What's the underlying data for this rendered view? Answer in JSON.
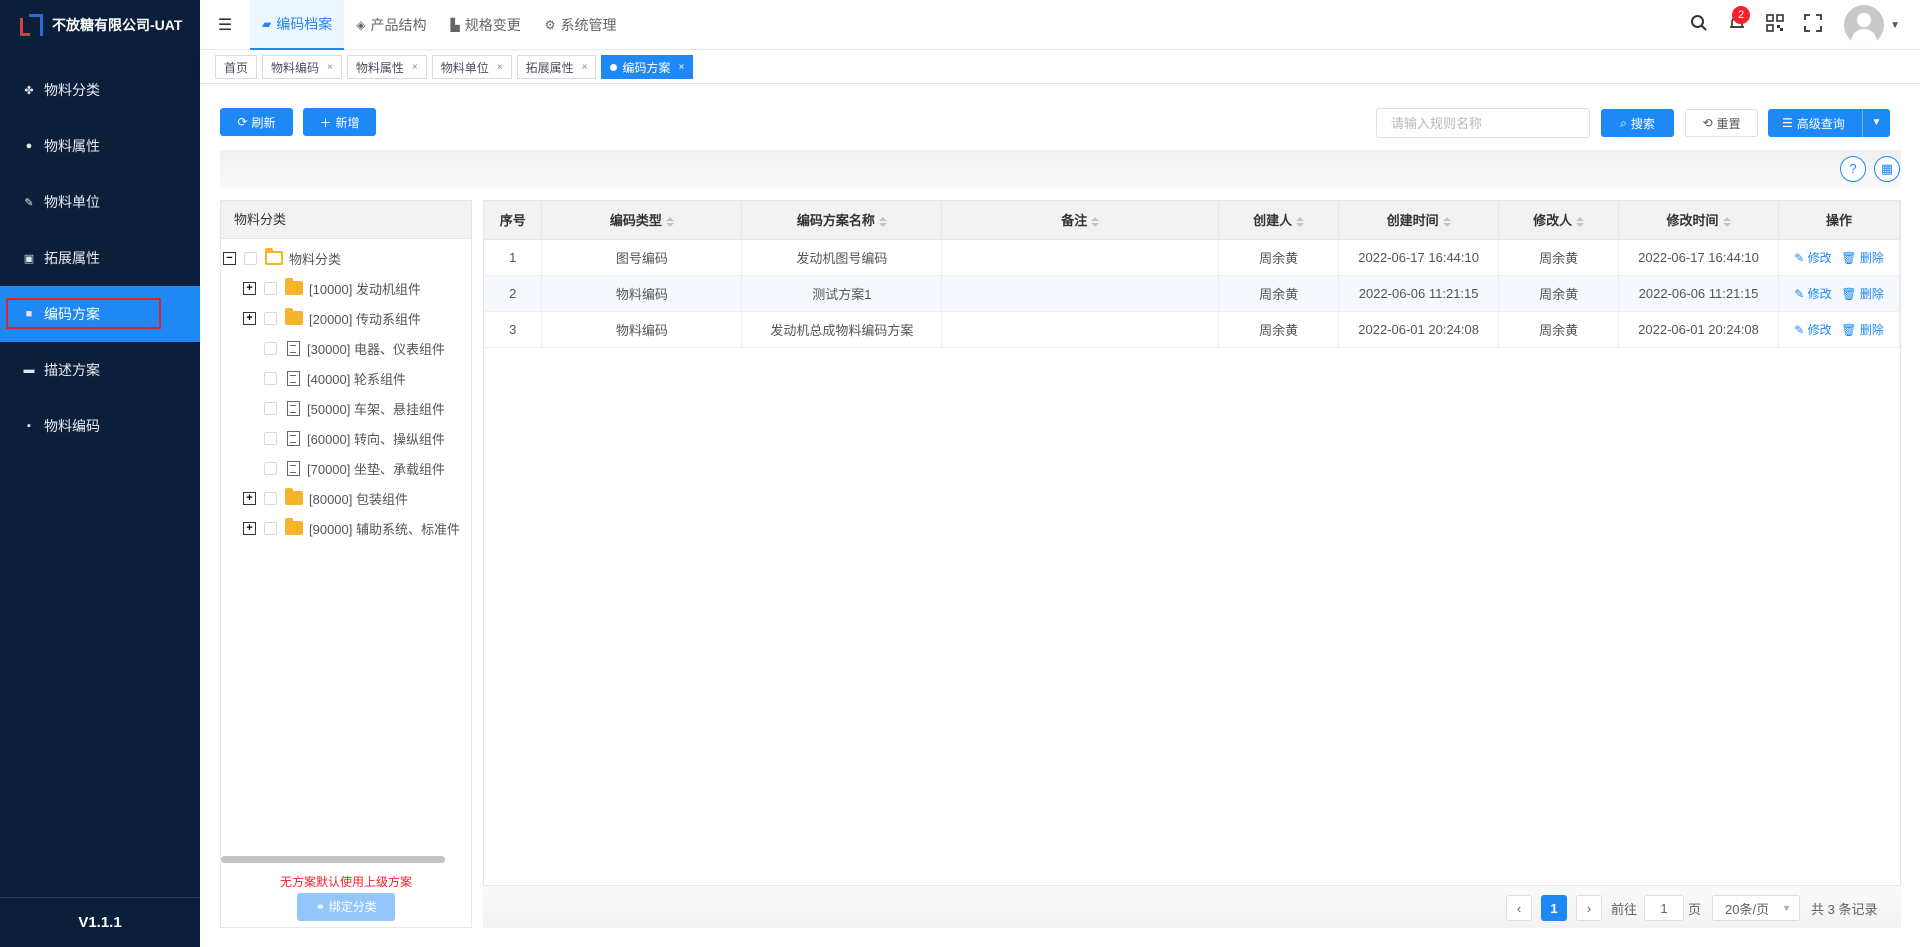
{
  "app": {
    "title": "不放糖有限公司-UAT",
    "version": "V1.1.1"
  },
  "sidebar": {
    "items": [
      {
        "label": "物料分类",
        "icon": "grid-icon"
      },
      {
        "label": "物料属性",
        "icon": "info-icon"
      },
      {
        "label": "物料单位",
        "icon": "wrench-icon"
      },
      {
        "label": "拓展属性",
        "icon": "image-icon"
      },
      {
        "label": "编码方案",
        "icon": "document-icon",
        "active": true
      },
      {
        "label": "描述方案",
        "icon": "monitor-icon"
      },
      {
        "label": "物料编码",
        "icon": "file-icon"
      }
    ]
  },
  "topnav": {
    "tabs": [
      {
        "label": "编码档案",
        "icon": "folder-icon",
        "active": true
      },
      {
        "label": "产品结构",
        "icon": "layers-icon"
      },
      {
        "label": "规格变更",
        "icon": "chart-icon"
      },
      {
        "label": "系统管理",
        "icon": "gear-icon"
      }
    ],
    "notification_count": "2"
  },
  "tags": [
    {
      "label": "首页"
    },
    {
      "label": "物料编码"
    },
    {
      "label": "物料属性"
    },
    {
      "label": "物料单位"
    },
    {
      "label": "拓展属性"
    },
    {
      "label": "编码方案",
      "active": true
    }
  ],
  "toolbar": {
    "refresh_label": "刷新",
    "add_label": "新增",
    "search_placeholder": "请输入规则名称",
    "search_label": "搜索",
    "reset_label": "重置",
    "advanced_label": "高级查询"
  },
  "tree": {
    "title": "物料分类",
    "nodes": [
      {
        "label": "物料分类",
        "type": "root"
      },
      {
        "label": "[10000] 发动机组件",
        "type": "folder"
      },
      {
        "label": "[20000] 传动系组件",
        "type": "folder"
      },
      {
        "label": "[30000] 电器、仪表组件",
        "type": "leaf"
      },
      {
        "label": "[40000] 轮系组件",
        "type": "leaf"
      },
      {
        "label": "[50000] 车架、悬挂组件",
        "type": "leaf"
      },
      {
        "label": "[60000] 转向、操纵组件",
        "type": "leaf"
      },
      {
        "label": "[70000] 坐垫、承载组件",
        "type": "leaf"
      },
      {
        "label": "[80000] 包装组件",
        "type": "folder"
      },
      {
        "label": "[90000] 辅助系统、标准件",
        "type": "folder"
      }
    ],
    "note": "无方案默认使用上级方案",
    "bind_label": "绑定分类"
  },
  "table": {
    "columns": [
      "序号",
      "编码类型",
      "编码方案名称",
      "备注",
      "创建人",
      "创建时间",
      "修改人",
      "修改时间",
      "操作"
    ],
    "rows": [
      [
        "1",
        "图号编码",
        "发动机图号编码",
        "",
        "周余黄",
        "2022-06-17 16:44:10",
        "周余黄",
        "2022-06-17 16:44:10"
      ],
      [
        "2",
        "物料编码",
        "测试方案1",
        "",
        "周余黄",
        "2022-06-06 11:21:15",
        "周余黄",
        "2022-06-06 11:21:15"
      ],
      [
        "3",
        "物料编码",
        "发动机总成物料编码方案",
        "",
        "周余黄",
        "2022-06-01 20:24:08",
        "周余黄",
        "2022-06-01 20:24:08"
      ]
    ],
    "edit_label": "修改",
    "delete_label": "删除"
  },
  "pagination": {
    "current_page": "1",
    "goto_prefix": "前往",
    "goto_value": "1",
    "goto_suffix": "页",
    "page_size": "20条/页",
    "total_text": "共 3 条记录"
  }
}
